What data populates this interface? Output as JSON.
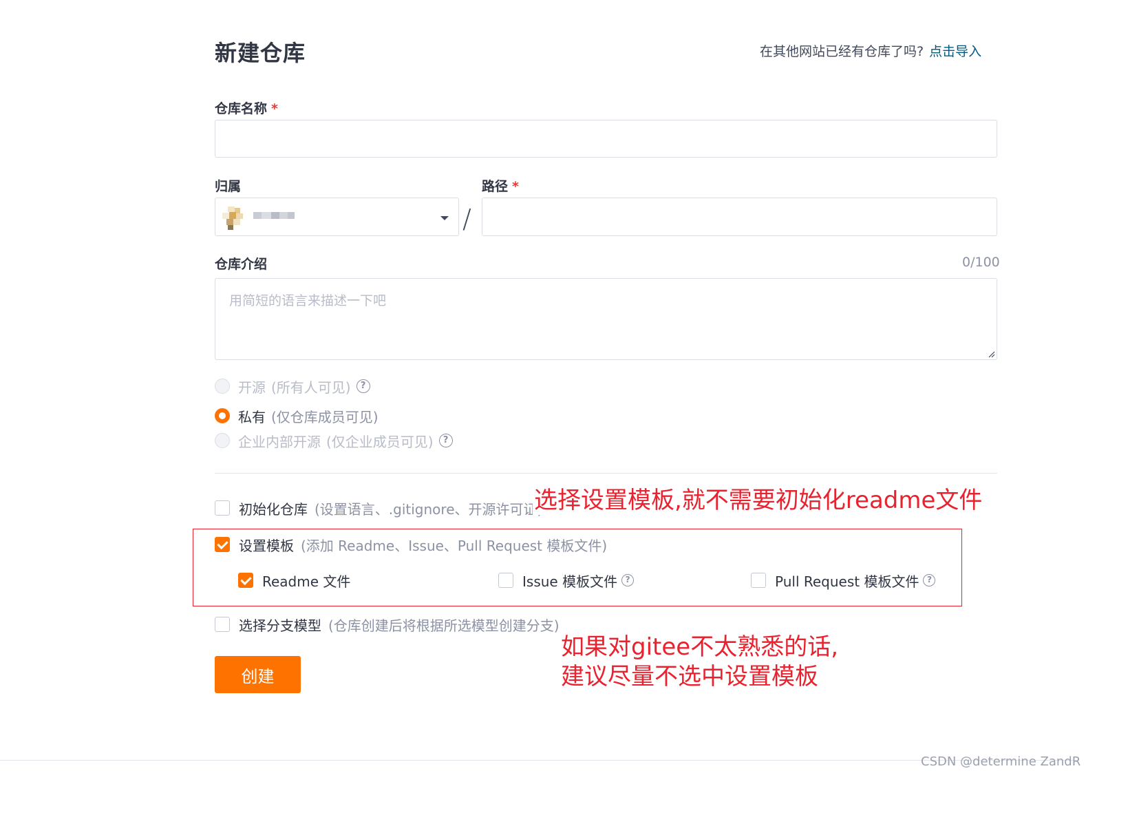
{
  "header": {
    "title": "新建仓库",
    "import_hint": "在其他网站已经有仓库了吗?",
    "import_link": "点击导入"
  },
  "form": {
    "repo_name": {
      "label": "仓库名称",
      "required_mark": "*",
      "value": "",
      "placeholder": ""
    },
    "owner": {
      "label": "归属",
      "value": ""
    },
    "separator": "/",
    "path": {
      "label": "路径",
      "required_mark": "*",
      "value": "",
      "placeholder": ""
    },
    "description": {
      "label": "仓库介绍",
      "counter": "0/100",
      "placeholder": "用简短的语言来描述一下吧",
      "value": ""
    },
    "visibility": [
      {
        "label": "开源",
        "sub": "(所有人可见)",
        "checked": false,
        "disabled": true,
        "help": true
      },
      {
        "label": "私有",
        "sub": "(仅仓库成员可见)",
        "checked": true,
        "disabled": false,
        "help": false
      },
      {
        "label": "企业内部开源",
        "sub": "(仅企业成员可见)",
        "checked": false,
        "disabled": true,
        "help": true
      }
    ],
    "init_repo": {
      "label": "初始化仓库",
      "sub": "(设置语言、.gitignore、开源许可证)",
      "checked": false
    },
    "template": {
      "label": "设置模板",
      "sub": "(添加 Readme、Issue、Pull Request 模板文件)",
      "checked": true,
      "options": [
        {
          "label": "Readme 文件",
          "checked": true,
          "help": false
        },
        {
          "label": "Issue 模板文件",
          "checked": false,
          "help": true
        },
        {
          "label": "Pull Request 模板文件",
          "checked": false,
          "help": true
        }
      ]
    },
    "branch_model": {
      "label": "选择分支模型",
      "sub": "(仓库创建后将根据所选模型创建分支)",
      "checked": false
    },
    "submit_label": "创建"
  },
  "annotations": {
    "template_note": "选择设置模板,就不需要初始化readme文件",
    "advice_line1": "如果对gitee不太熟悉的话,",
    "advice_line2": "建议尽量不选中设置模板"
  },
  "watermark": "CSDN @determine ZandR",
  "colors": {
    "accent": "#fe7300",
    "link": "#005980",
    "annotation": "#e8232f"
  },
  "icons": {
    "help": "question-circle-icon",
    "caret": "caret-down-icon",
    "check": "checkmark-icon"
  }
}
